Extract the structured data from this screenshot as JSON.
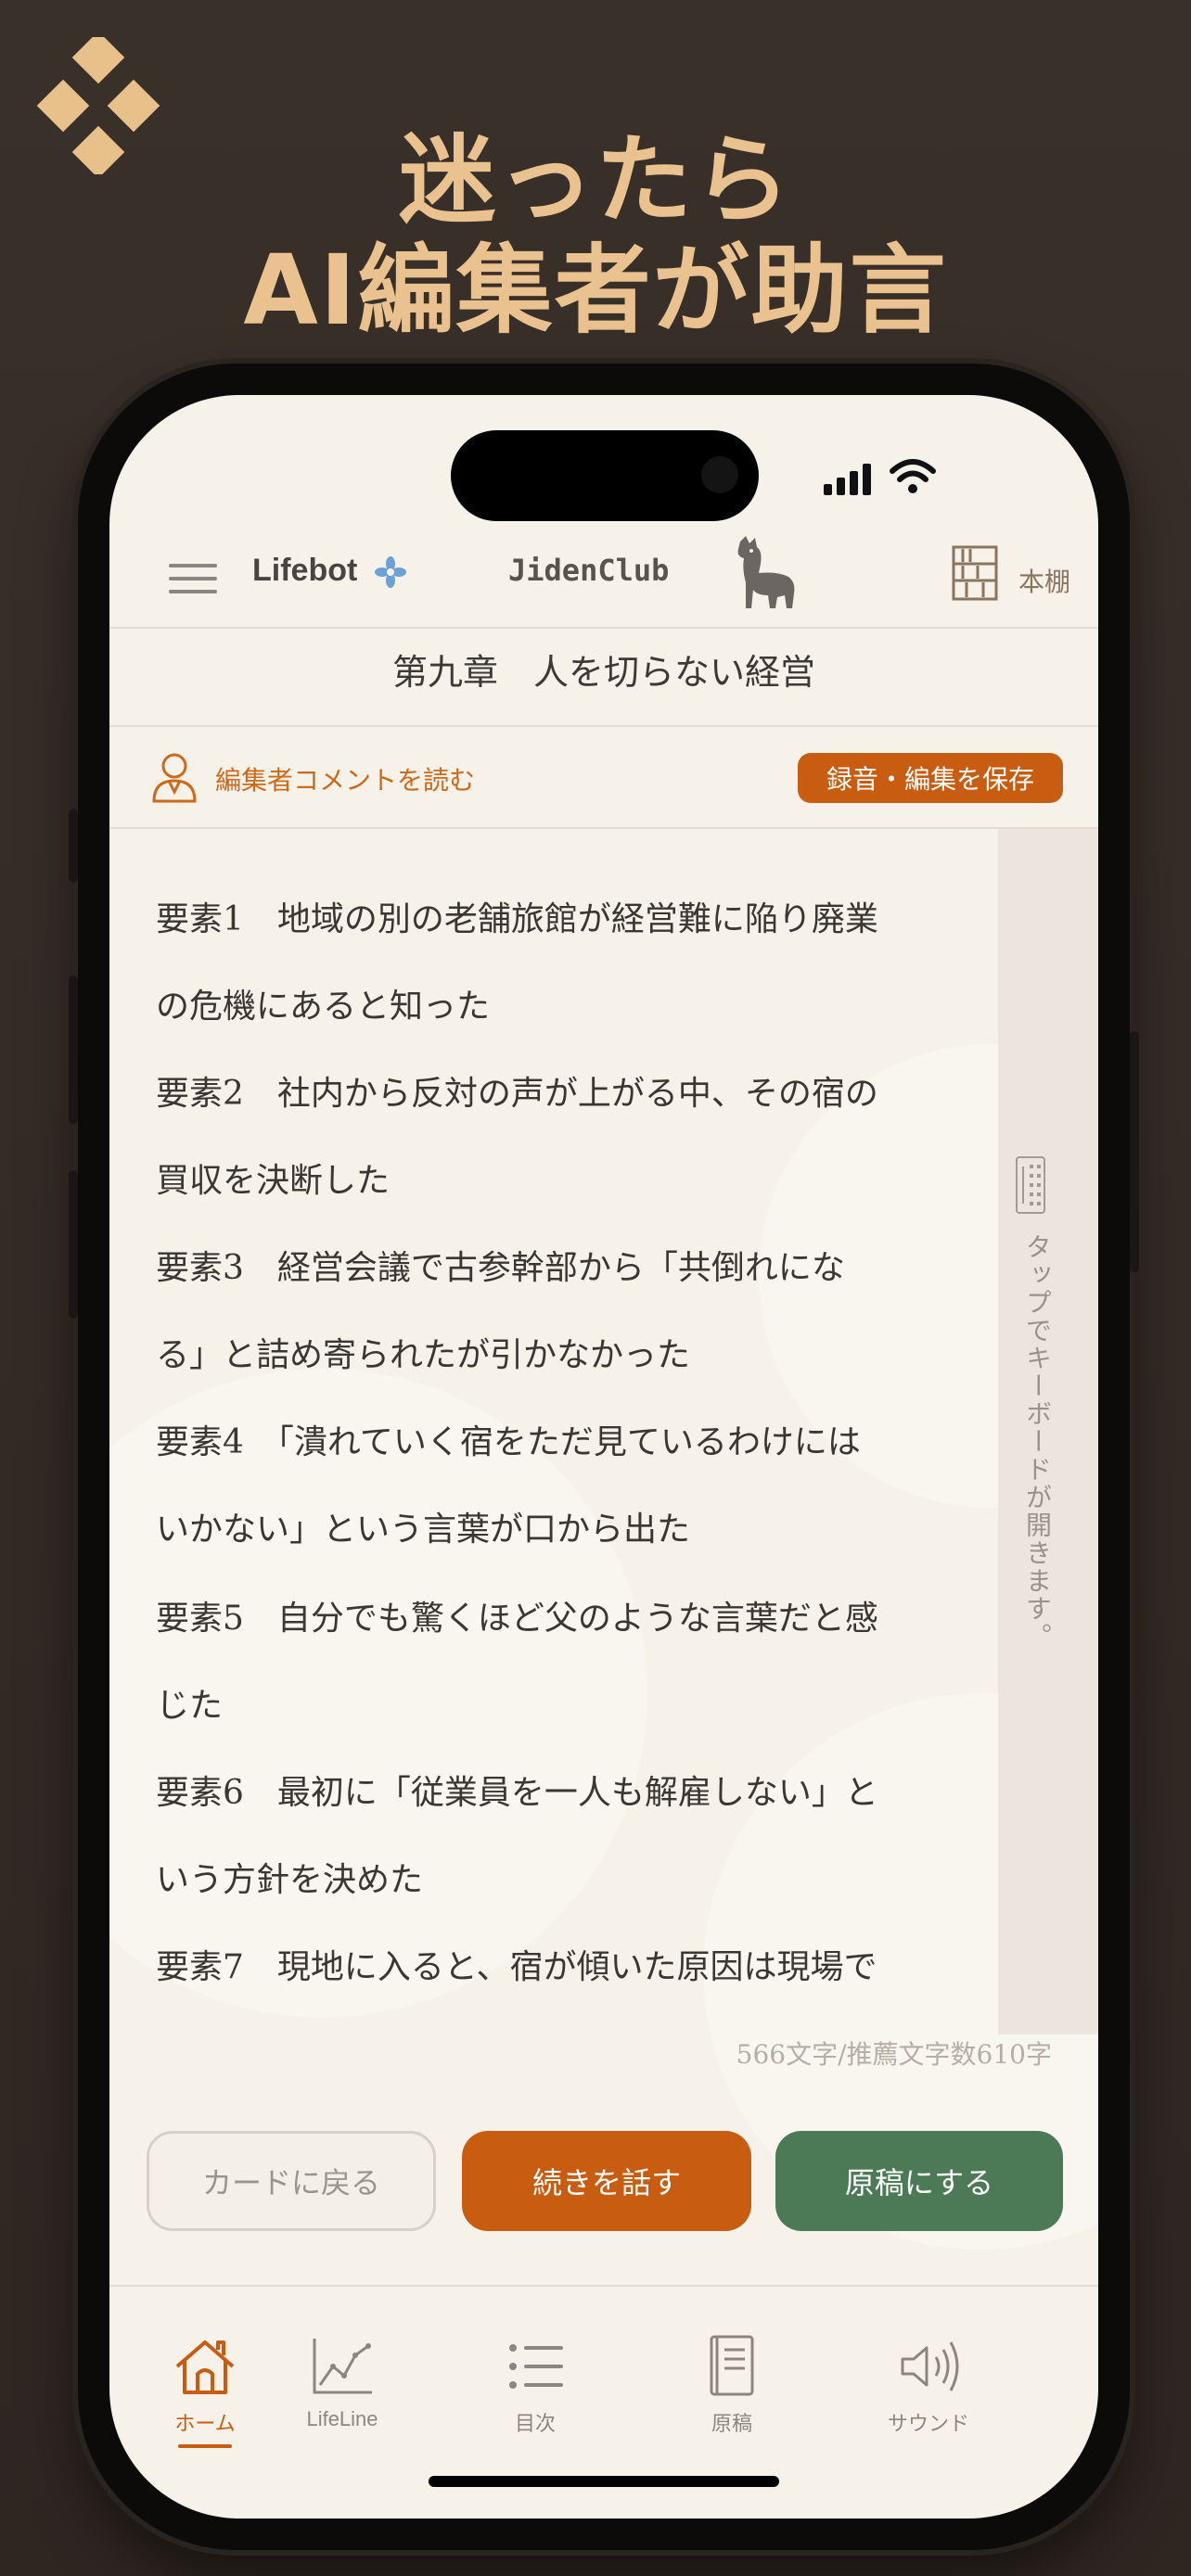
{
  "promo": {
    "headline_line1": "迷ったら",
    "headline_line2": "AI編集者が助言"
  },
  "header": {
    "brand": "Lifebot",
    "club": "JidenClub",
    "shelf_label": "本棚"
  },
  "chapter_title": "第九章　人を切らない経営",
  "editor": {
    "comment_link": "編集者コメントを読む",
    "save_button": "録音・編集を保存"
  },
  "elements": [
    {
      "line1": "要素1　地域の別の老舗旅館が経営難に陥り廃業",
      "line2": "の危機にあると知った"
    },
    {
      "line1": "要素2　社内から反対の声が上がる中、その宿の",
      "line2": "買収を決断した"
    },
    {
      "line1": "要素3　経営会議で古参幹部から「共倒れにな",
      "line2": "る」と詰め寄られたが引かなかった"
    },
    {
      "line1": "要素4　「潰れていく宿をただ見ているわけには",
      "line2": "いかない」という言葉が口から出た"
    },
    {
      "line1": "要素5　自分でも驚くほど父のような言葉だと感",
      "line2": "じた"
    },
    {
      "line1": "要素6　最初に「従業員を一人も解雇しない」と",
      "line2": "いう方針を決めた"
    },
    {
      "line1": "要素7　現地に入ると、宿が傾いた原因は現場で",
      "line2": ""
    }
  ],
  "side_hint": "タップでキーボードが開きます。",
  "char_count": "566文字/推薦文字数610字",
  "actions": {
    "back": "カードに戻る",
    "continue": "続きを話す",
    "draft": "原稿にする"
  },
  "tabs": [
    {
      "label": "ホーム",
      "icon": "home-icon",
      "active": true
    },
    {
      "label": "LifeLine",
      "icon": "chart-line-icon",
      "active": false
    },
    {
      "label": "目次",
      "icon": "list-icon",
      "active": false
    },
    {
      "label": "原稿",
      "icon": "book-icon",
      "active": false
    },
    {
      "label": "サウンド",
      "icon": "speaker-icon",
      "active": false
    }
  ],
  "colors": {
    "accent": "#c85d12",
    "green": "#4c7a56",
    "headline": "#e9c28f",
    "background": "#f6f1e9"
  }
}
